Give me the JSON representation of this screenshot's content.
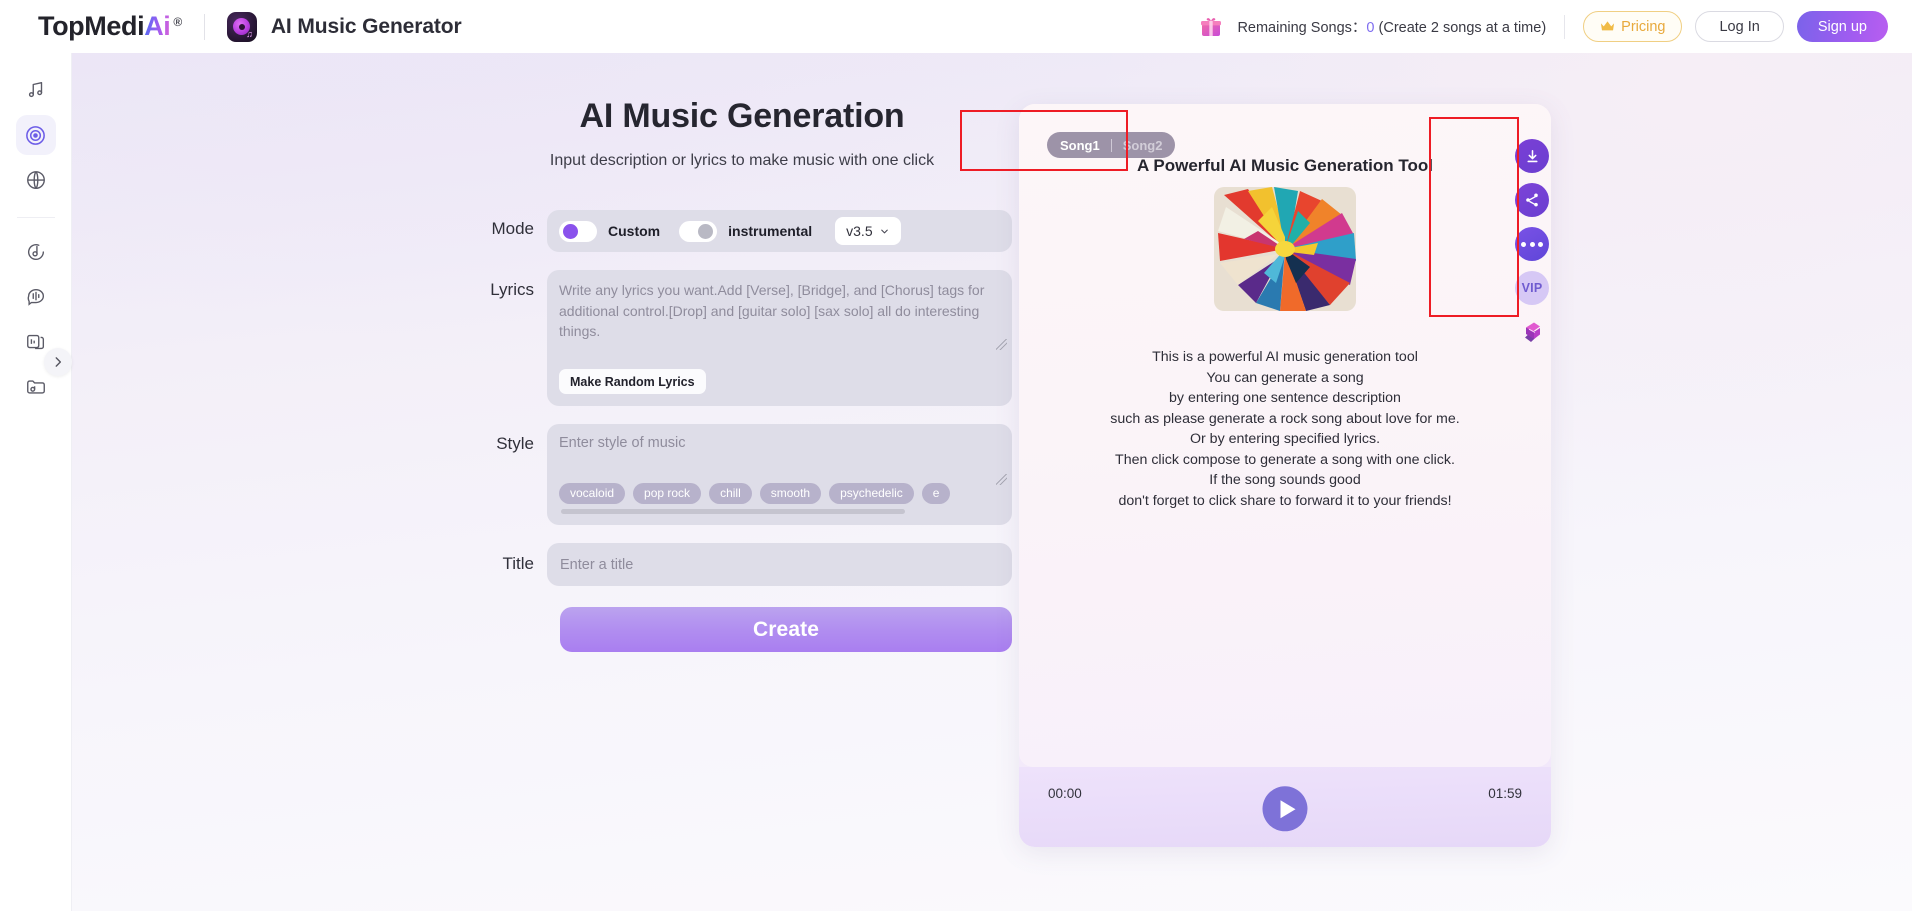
{
  "header": {
    "brand_prefix": "TopMedi",
    "brand_accent": "Ai",
    "brand_reg": "®",
    "app_title": "AI Music Generator",
    "gift_icon": "gift-icon",
    "remaining_label": "Remaining Songs：",
    "remaining_count": "0",
    "remaining_note": "(Create 2 songs at a time)",
    "pricing_label": "Pricing",
    "crown_icon": "crown-icon",
    "login_label": "Log In",
    "signup_label": "Sign up"
  },
  "sidebar": {
    "items": [
      {
        "name": "music-note-icon",
        "label": "AI Music",
        "active": false
      },
      {
        "name": "vinyl-disc-icon",
        "label": "AI Music Generator",
        "active": true
      },
      {
        "name": "globe-icon",
        "label": "AI Cover",
        "active": false
      },
      {
        "name": "music-circle-icon",
        "label": "Voice Changer",
        "active": false
      },
      {
        "name": "speech-waveform-icon",
        "label": "Text to Speech",
        "active": false
      },
      {
        "name": "stacked-cards-icon",
        "label": "Library",
        "active": false
      },
      {
        "name": "folder-audio-icon",
        "label": "My Files",
        "active": false
      }
    ],
    "expand_icon": "chevron-right-icon"
  },
  "main": {
    "title": "AI Music Generation",
    "subtitle": "Input description or lyrics to make music with one click",
    "mode": {
      "label": "Mode",
      "custom_label": "Custom",
      "custom_on": true,
      "instrumental_label": "instrumental",
      "instrumental_on": false,
      "version": "v3.5",
      "version_caret": "chevron-down-icon"
    },
    "lyrics": {
      "label": "Lyrics",
      "placeholder": "Write any lyrics you want.Add [Verse], [Bridge], and [Chorus] tags for additional control.[Drop] and [guitar solo] [sax solo] all do interesting things.",
      "value": "",
      "random_button": "Make Random Lyrics"
    },
    "style": {
      "label": "Style",
      "placeholder": "Enter style of music",
      "value": "",
      "tags": [
        "vocaloid",
        "pop rock",
        "chill",
        "smooth",
        "psychedelic",
        "e"
      ]
    },
    "title_field": {
      "label": "Title",
      "placeholder": "Enter a title",
      "value": ""
    },
    "create_button": "Create"
  },
  "song_panel": {
    "tabs": [
      {
        "label": "Song1",
        "active": true
      },
      {
        "label": "Song2",
        "active": false
      }
    ],
    "heading": "A Powerful AI Music Generation Tool",
    "cover_art": "abstract-color-burst-cover",
    "description_lines": [
      "This is a powerful AI music generation tool",
      "You can generate a song",
      "by entering one sentence description",
      "such as please generate a rock song about love for me.",
      "Or by entering specified lyrics.",
      "Then click compose to generate a song with one click.",
      "If the song sounds good",
      "don't forget to click share to forward it to your friends!"
    ],
    "player": {
      "current_time": "00:00",
      "total_time": "01:59",
      "play_icon": "play-icon"
    },
    "actions": [
      {
        "name": "download-icon",
        "label": "Download"
      },
      {
        "name": "share-icon",
        "label": "Share"
      },
      {
        "name": "more-icon",
        "label": "More"
      },
      {
        "name": "vip-badge",
        "label": "VIP"
      },
      {
        "name": "book-icon",
        "label": "Book"
      }
    ]
  },
  "colors": {
    "accent": "#8a52ec",
    "signup_gradient_start": "#7b63ea",
    "signup_gradient_end": "#b85ef0",
    "pricing": "#e8a93c",
    "annotation": "#ee1c25",
    "field_bg": "#dedde8",
    "tag_bg": "#b7b2cb"
  }
}
